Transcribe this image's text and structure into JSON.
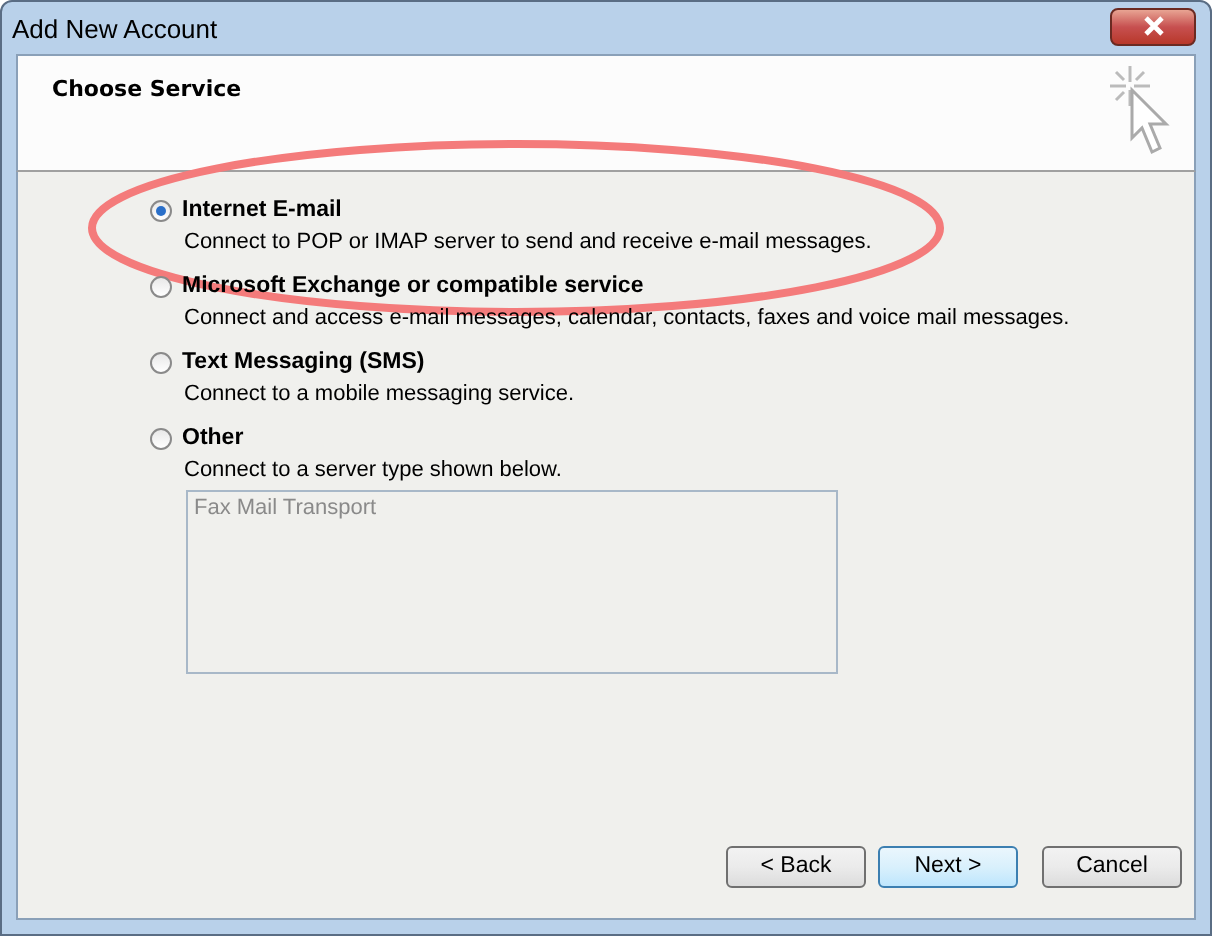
{
  "window": {
    "title": "Add New Account"
  },
  "header": {
    "title": "Choose Service"
  },
  "options": [
    {
      "label": "Internet E-mail",
      "description": "Connect to POP or IMAP server to send and receive e-mail messages.",
      "selected": true,
      "highlighted": true
    },
    {
      "label": "Microsoft Exchange or compatible service",
      "description": "Connect and access e-mail messages, calendar, contacts, faxes and voice mail messages.",
      "selected": false,
      "highlighted": false
    },
    {
      "label": "Text Messaging (SMS)",
      "description": "Connect to a mobile messaging service.",
      "selected": false,
      "highlighted": false
    },
    {
      "label": "Other",
      "description": "Connect to a server type shown below.",
      "selected": false,
      "highlighted": false,
      "list": {
        "disabled": true,
        "items": [
          "Fax Mail Transport"
        ]
      }
    }
  ],
  "buttons": [
    {
      "label": "< Back",
      "default": false
    },
    {
      "label": "Next >",
      "default": true
    },
    {
      "label": "Cancel",
      "default": false
    }
  ]
}
